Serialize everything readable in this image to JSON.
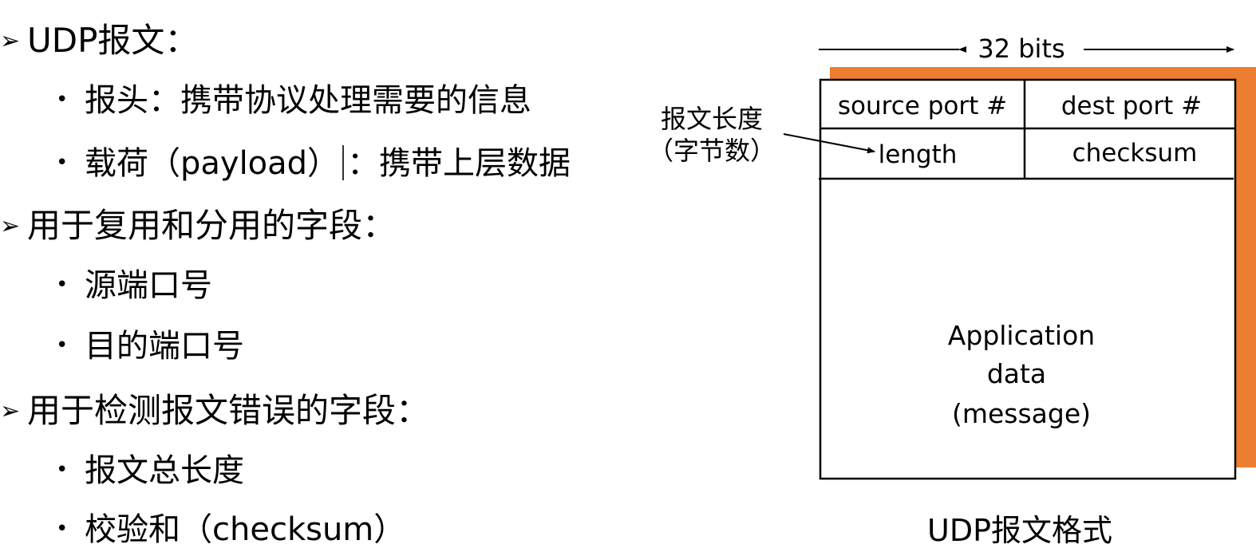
{
  "bullets": {
    "udp_segment": {
      "marker": "➢",
      "label": "UDP报文："
    },
    "header_item": {
      "bullet": "•",
      "label": "报头：携带协议处理需要的信息"
    },
    "payload_item": {
      "bullet": "•",
      "label_before": "载荷（payload）",
      "label_after": "：携带上层数据"
    },
    "mux_fields": {
      "marker": "➢",
      "label": "用于复用和分用的字段："
    },
    "source_port_item": {
      "bullet": "•",
      "label": "源端口号"
    },
    "dest_port_item": {
      "bullet": "•",
      "label": "目的端口号"
    },
    "error_fields": {
      "marker": "➢",
      "label": "用于检测报文错误的字段："
    },
    "length_item": {
      "bullet": "•",
      "label": "报文总长度"
    },
    "checksum_item": {
      "bullet": "•",
      "label": "校验和（checksum）"
    }
  },
  "diagram": {
    "width_label": "32 bits",
    "annotation_line1": "报文长度",
    "annotation_line2": "（字节数）",
    "fields": {
      "source_port": "source port #",
      "dest_port": "dest port #",
      "length": "length",
      "checksum": "checksum",
      "app_data_line1": "Application",
      "app_data_line2": "data",
      "app_data_line3": "(message)"
    },
    "caption": "UDP报文格式",
    "colors": {
      "accent_shadow": "#ED7D31",
      "border": "#000000"
    }
  }
}
